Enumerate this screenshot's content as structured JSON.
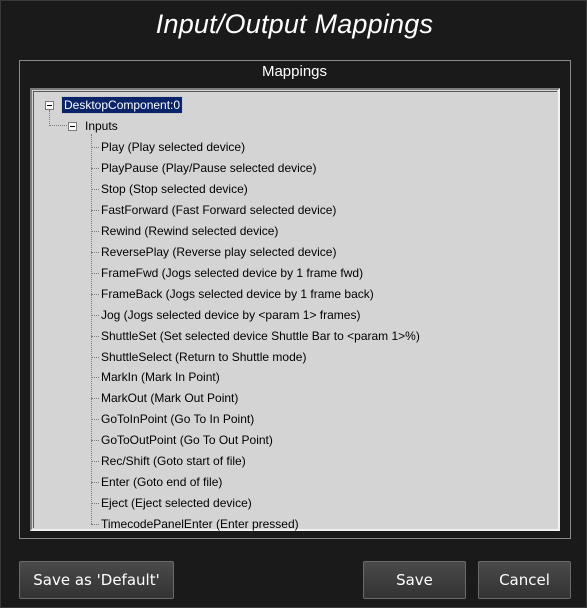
{
  "window": {
    "title": "Input/Output Mappings"
  },
  "group": {
    "label": "Mappings"
  },
  "tree": {
    "root": "DesktopComponent:0",
    "inputs": "Inputs",
    "items": [
      "Play (Play selected device)",
      "PlayPause (Play/Pause selected device)",
      "Stop (Stop selected device)",
      "FastForward (Fast Forward selected device)",
      "Rewind (Rewind selected device)",
      "ReversePlay (Reverse play selected device)",
      "FrameFwd (Jogs selected device by 1 frame fwd)",
      "FrameBack (Jogs selected device by 1 frame back)",
      "Jog (Jogs selected device by <param 1> frames)",
      "ShuttleSet (Set selected device Shuttle Bar to <param 1>%)",
      "ShuttleSelect (Return to Shuttle mode)",
      "MarkIn (Mark In Point)",
      "MarkOut (Mark Out Point)",
      "GoToInPoint (Go To In Point)",
      "GoToOutPoint (Go To Out Point)",
      "Rec/Shift (Goto start of file)",
      "Enter (Goto end of file)",
      "Eject (Eject selected device)",
      "TimecodePanelEnter (Enter pressed)"
    ]
  },
  "buttons": {
    "save_default": "Save as 'Default'",
    "save": "Save",
    "cancel": "Cancel"
  }
}
